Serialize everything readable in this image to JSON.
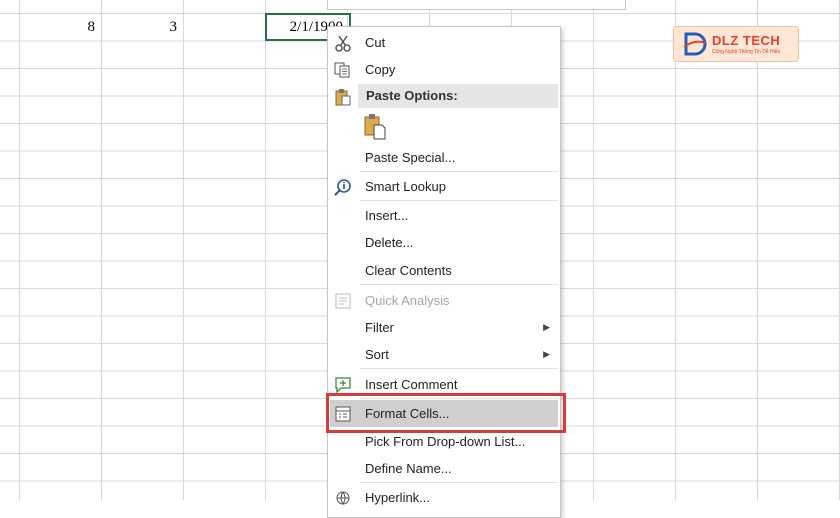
{
  "cells": {
    "a": "8",
    "b": "3",
    "c": "2/1/1900"
  },
  "logo": {
    "brand": "DLZ TECH",
    "tagline": "Công Nghệ Thông Tin Dễ Hiểu"
  },
  "menu": {
    "cut": "Cut",
    "copy": "Copy",
    "paste_options": "Paste Options:",
    "paste_special": "Paste Special...",
    "smart_lookup": "Smart Lookup",
    "insert": "Insert...",
    "delete": "Delete...",
    "clear_contents": "Clear Contents",
    "quick_analysis": "Quick Analysis",
    "filter": "Filter",
    "sort": "Sort",
    "insert_comment": "Insert Comment",
    "format_cells": "Format Cells...",
    "pick_list": "Pick From Drop-down List...",
    "define_name": "Define Name...",
    "hyperlink": "Hyperlink..."
  },
  "colors": {
    "highlight_box": "#d93b3b",
    "selected_cell_border": "#217346",
    "logo_accent": "#e6402b"
  }
}
